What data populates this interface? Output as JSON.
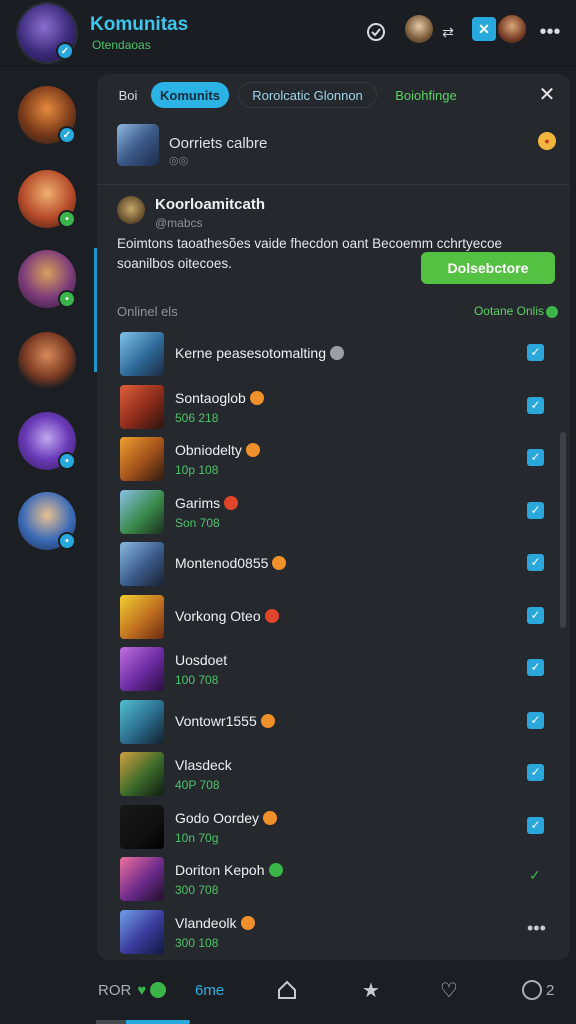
{
  "header": {
    "title": "Komunitas",
    "subtitle": "Otendaoas",
    "icons": [
      "support-icon",
      "user-avatar",
      "link-icon",
      "tool-icon",
      "user-avatar-2",
      "more-icon"
    ]
  },
  "sidebar": {
    "servers": [
      {
        "name": "server-1",
        "badge": "check"
      },
      {
        "name": "server-2",
        "badge": "green"
      },
      {
        "name": "server-3",
        "badge": "green"
      },
      {
        "name": "server-4",
        "badge": "none"
      },
      {
        "name": "server-5",
        "badge": "blue"
      },
      {
        "name": "server-6",
        "badge": "blue"
      }
    ]
  },
  "tabs": {
    "plain": "Boi",
    "active": "Komunits",
    "outline": "Rorolcatic Glonnon",
    "green": "Boiohfinge"
  },
  "channel": {
    "name": "Oorriets calbre",
    "sub": "◎◎"
  },
  "post": {
    "author": "Koorloamitcath",
    "handle": "@mabcs",
    "text": "Eoimtons taoathesões vaide fhecdon oant Becoemm cchrtyecoe soanilbos oitecoes.",
    "button": "Dolsebctore"
  },
  "online": {
    "label": "Onlinel els",
    "right": "Ootane Onlis"
  },
  "members": [
    {
      "name": "Kerne peasesotomalting",
      "status": "",
      "emoji": "grey",
      "check": "box"
    },
    {
      "name": "Sontaoglob",
      "status": "506 218",
      "emoji": "orange",
      "check": "box"
    },
    {
      "name": "Obniodelty",
      "status": "10p 108",
      "emoji": "orange",
      "check": "box"
    },
    {
      "name": "Garims",
      "status": "Son 708",
      "emoji": "red",
      "check": "box"
    },
    {
      "name": "Montenod0855",
      "status": "",
      "emoji": "orange",
      "check": "box"
    },
    {
      "name": "Vorkong Oteo",
      "status": "",
      "emoji": "red",
      "check": "box"
    },
    {
      "name": "Uosdoet",
      "status": "100 708",
      "emoji": "",
      "check": "box"
    },
    {
      "name": "Vontowr1555",
      "status": "",
      "emoji": "orange",
      "check": "box"
    },
    {
      "name": "Vlasdeck",
      "status": "40P 708",
      "emoji": "",
      "check": "box"
    },
    {
      "name": "Godo Oordey",
      "status": "10n 70g",
      "emoji": "orange",
      "check": "box"
    },
    {
      "name": "Doriton Kepoh",
      "status": "300 708",
      "emoji": "green",
      "check": "plain"
    },
    {
      "name": "Vlandeolk",
      "status": "300 108",
      "emoji": "orange",
      "check": "more"
    }
  ],
  "bottom_nav": {
    "item1": "ROR",
    "item2": "6me",
    "count": "2"
  },
  "colors": {
    "accent": "#2bb3e6",
    "green": "#55c142",
    "panel": "#25292e",
    "bg": "#1b1e22"
  }
}
